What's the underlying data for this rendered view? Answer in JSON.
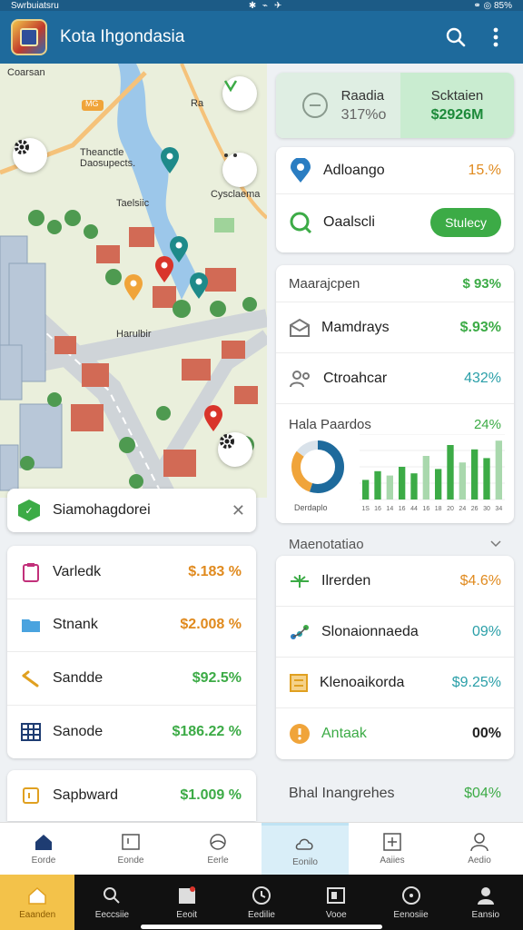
{
  "status": {
    "left": "Swrbuiatsru",
    "mid": "✱ ⌁ ✈",
    "right": "⚭ ◎ 85%"
  },
  "app": {
    "title": "Kota Ihgondasia"
  },
  "map": {
    "labels": {
      "top_left": "Coarsan",
      "mid": "Theanctle Daosupects.",
      "mid2": "Taelsiic",
      "right": "Cysclaema",
      "lower": "Harulbir",
      "bubble": "MG",
      "ra": "Ra"
    },
    "search": {
      "label": "Siamohagdorei"
    }
  },
  "left_list": [
    {
      "name": "Varledk",
      "value": "$.183 %",
      "color": "#e08a1e",
      "icon": "clipboard-icon"
    },
    {
      "name": "Stnank",
      "value": "$2.008 %",
      "color": "#e08a1e",
      "icon": "folder-icon"
    },
    {
      "name": "Sandde",
      "value": "$92.5%",
      "color": "#3cab46",
      "icon": "pen-icon"
    },
    {
      "name": "Sanode",
      "value": "$186.22 %",
      "color": "#3cab46",
      "icon": "grid-icon"
    }
  ],
  "left_single": {
    "name": "Sapbward",
    "value": "$1.009 %",
    "color": "#3cab46"
  },
  "stats": {
    "left_title": "Raadia",
    "left_value": "317%o",
    "right_title": "Scktaien",
    "right_value": "$2926M"
  },
  "right_top": [
    {
      "name": "Adloango",
      "value": "15.%",
      "color": "#e08a1e",
      "icon": "location-icon"
    },
    {
      "name": "Oaalscli",
      "pill": "Stulecy",
      "icon": "chat-icon"
    }
  ],
  "chart_card": {
    "header": {
      "title": "Maarajcpen",
      "value": "$ 93%"
    },
    "rows": [
      {
        "name": "Mamdrays",
        "value": "$.93%",
        "color": "#3cab46",
        "icon": "mail-icon"
      },
      {
        "name": "Ctroahcar",
        "value": "432%",
        "color": "#2a9fa8",
        "icon": "people-icon"
      }
    ],
    "chart_title": "Hala Paardos",
    "chart_value": "24%",
    "donut_label": "Derdaplo"
  },
  "chart_data": {
    "type": "bar",
    "title": "Hala Paardos",
    "categories": [
      "1S",
      "16",
      "14",
      "16",
      "44",
      "16",
      "18",
      "20",
      "24",
      "26",
      "30",
      "34"
    ],
    "values": [
      18,
      26,
      22,
      30,
      24,
      40,
      28,
      50,
      34,
      46,
      38,
      54
    ],
    "ylim": [
      0,
      60
    ],
    "colors": [
      "#3cab46",
      "#a9d8ad"
    ]
  },
  "donut": {
    "segments": [
      {
        "value": 55,
        "color": "#1e6a9c"
      },
      {
        "value": 30,
        "color": "#f0a43a"
      },
      {
        "value": 15,
        "color": "#d9e2ea"
      }
    ]
  },
  "section": {
    "title": "Maenotatiao"
  },
  "bottom_list": [
    {
      "name": "Ilrerden",
      "value": "$4.6%",
      "color": "#e08a1e",
      "icon": "plant-icon"
    },
    {
      "name": "Slonaionnaeda",
      "value": "09%",
      "color": "#2a9fa8",
      "icon": "network-icon"
    },
    {
      "name": "Klenoaikorda",
      "value": "$9.25%",
      "color": "#2a9fa8",
      "icon": "list-icon"
    },
    {
      "name": "Antaak",
      "value": "00%",
      "color": "#222",
      "icon": "alert-icon",
      "name_color": "#3cab46"
    }
  ],
  "footer": {
    "name": "Bhal Inangrehes",
    "value": "$04%"
  },
  "tabs": [
    {
      "label": "Eorde",
      "icon": "home-icon"
    },
    {
      "label": "Eonde",
      "icon": "card-icon"
    },
    {
      "label": "Eerle",
      "icon": "globe-icon"
    },
    {
      "label": "Eonilo",
      "icon": "cloud-icon"
    },
    {
      "label": "Aaiies",
      "icon": "plus-box-icon"
    },
    {
      "label": "Aedio",
      "icon": "user-icon"
    }
  ],
  "sysnav": [
    {
      "label": "Eaanden",
      "icon": "home-icon"
    },
    {
      "label": "Eeccsiie",
      "icon": "search-icon"
    },
    {
      "label": "Eeoit",
      "icon": "calendar-icon"
    },
    {
      "label": "Eedilie",
      "icon": "clock-icon"
    },
    {
      "label": "Vooe",
      "icon": "window-icon"
    },
    {
      "label": "Eenosiie",
      "icon": "compass-icon"
    },
    {
      "label": "Eansio",
      "icon": "person-icon"
    }
  ]
}
